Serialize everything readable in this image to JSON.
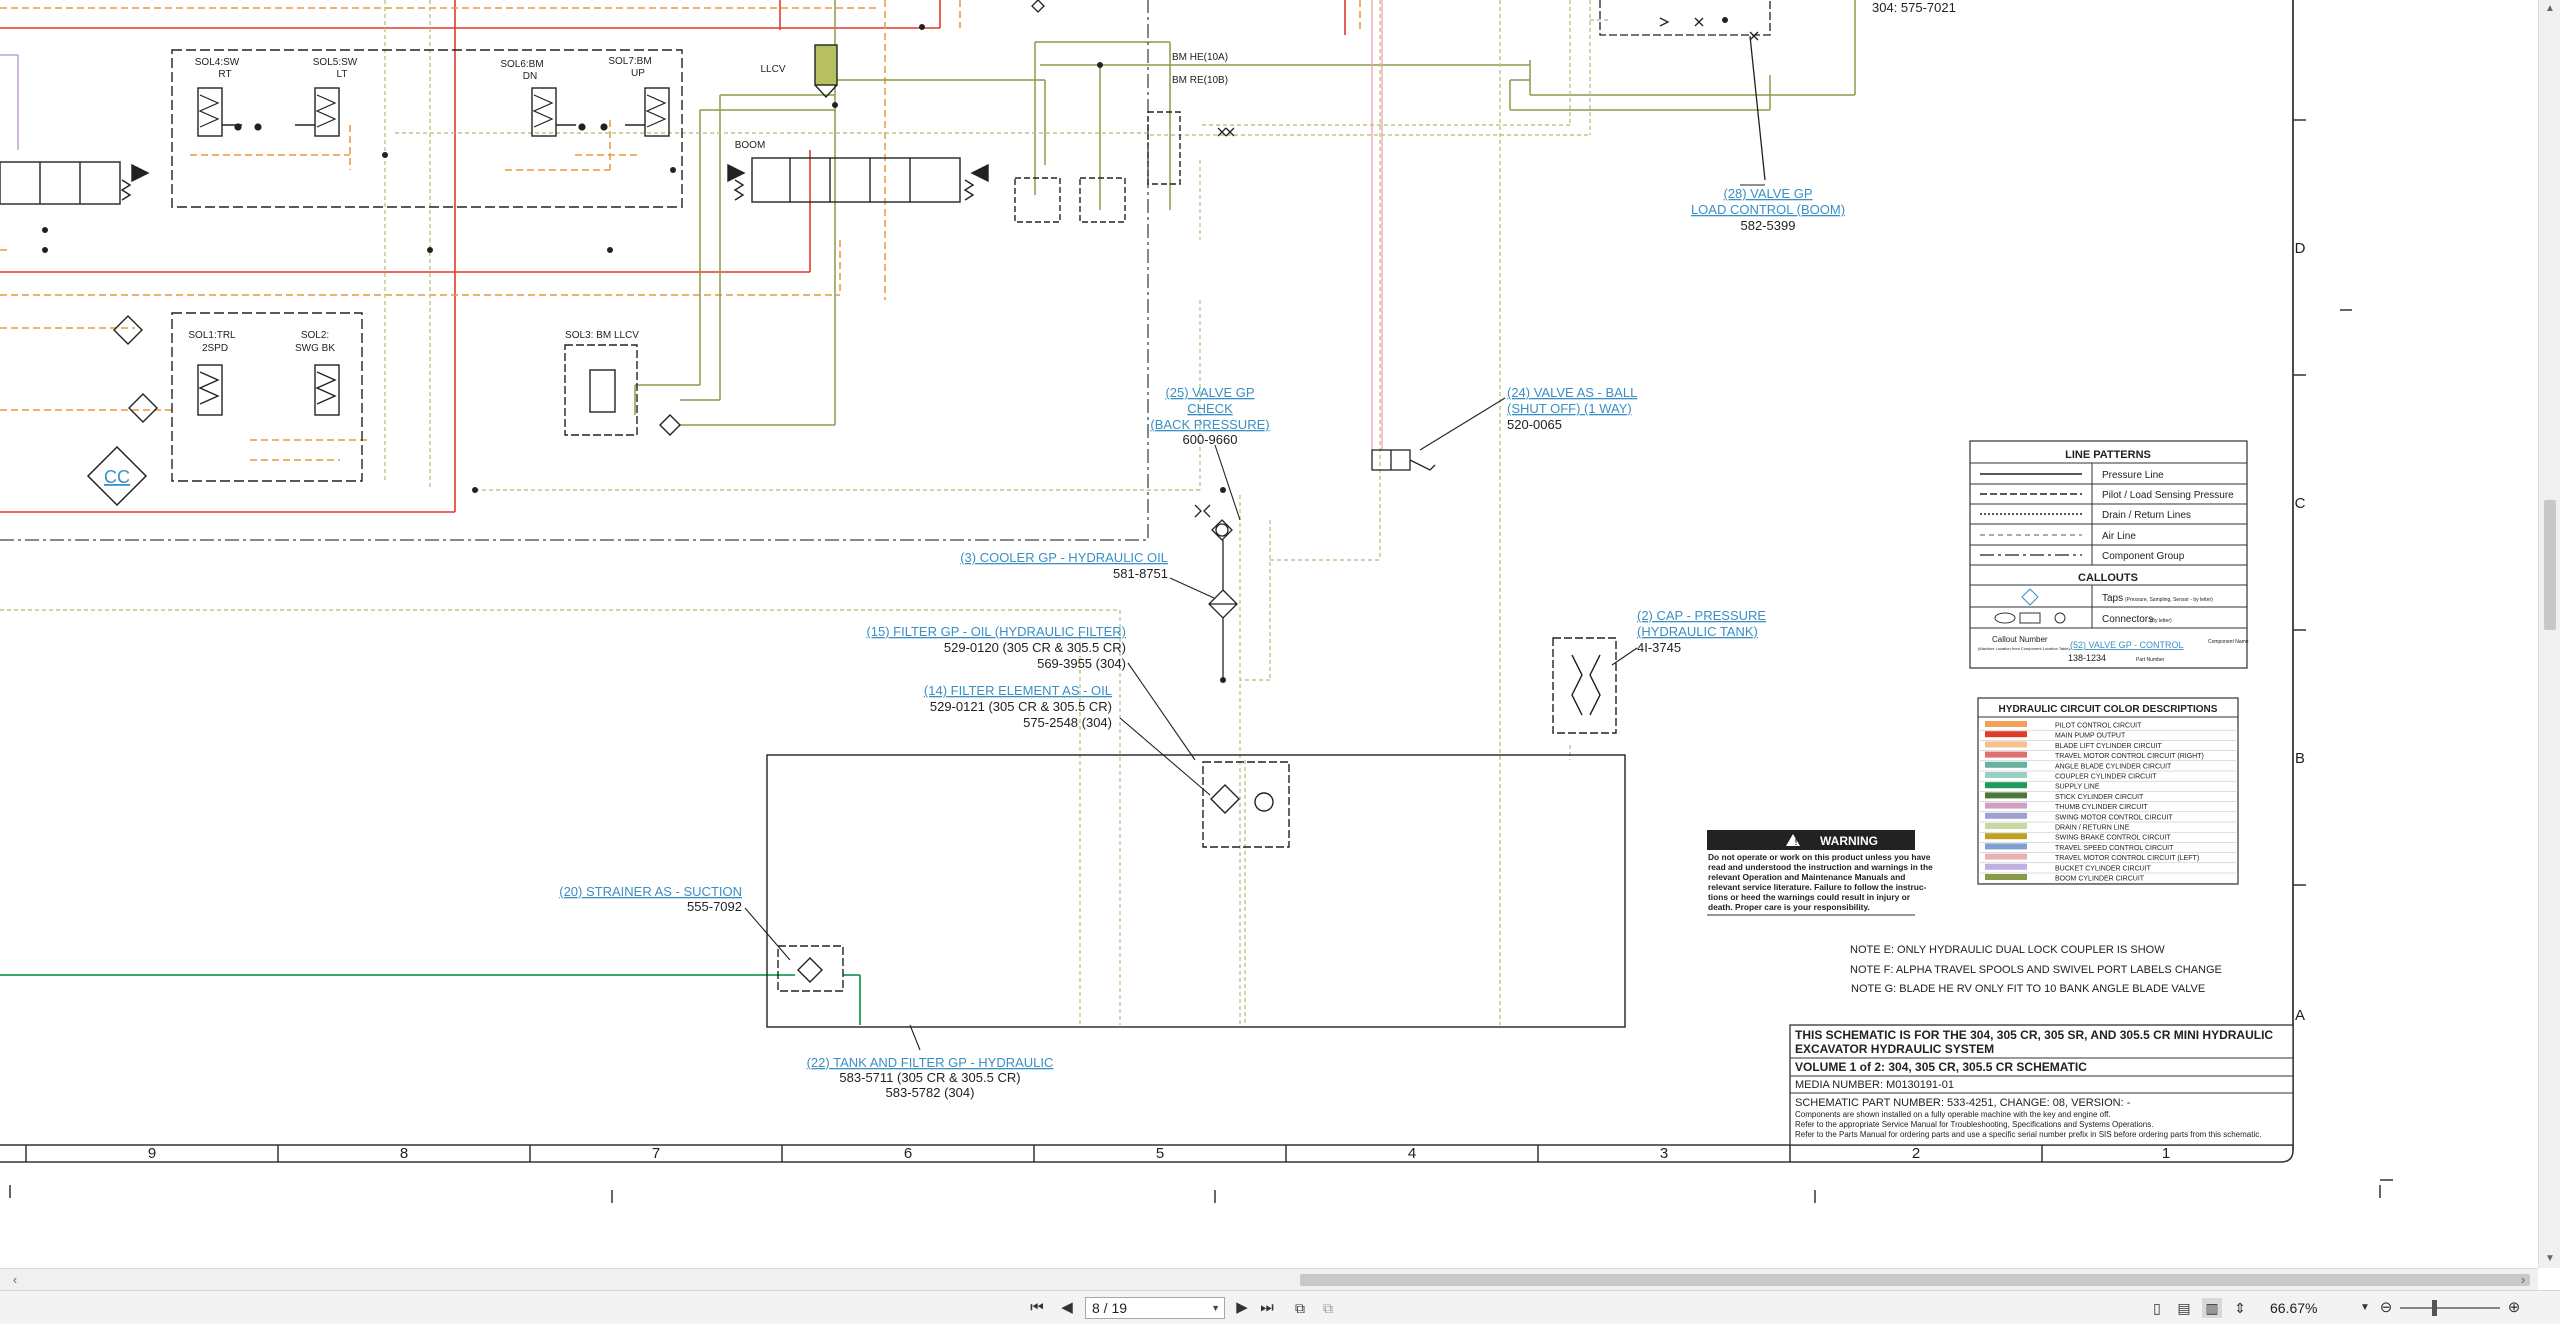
{
  "app": {
    "page_indicator": "8 / 19",
    "zoom": "66.67%"
  },
  "colors": {
    "pressure_red": "#e03a2a",
    "pilot_orange": "#e89a3a",
    "boom_olive": "#8a9a4a",
    "return_green": "#b7c98a",
    "supply_green": "#1f9a5a",
    "callout_blue": "#3a8fc4",
    "pink_line": "#f0a0a8",
    "lilac_line": "#b090d0"
  },
  "schematic": {
    "top_part_number": "304: 575-7021",
    "component_labels": {
      "sol4": "SOL4:SW",
      "sol4b": "RT",
      "sol5": "SOL5:SW",
      "sol5b": "LT",
      "sol6": "SOL6:BM",
      "sol6b": "DN",
      "sol7": "SOL7:BM",
      "sol7b": "UP",
      "llcv": "LLCV",
      "boom": "BOOM",
      "bm_he": "BM HE(10A)",
      "bm_re": "BM RE(10B)",
      "sol1": "SOL1:TRL",
      "sol1b": "2SPD",
      "sol2": "SOL2:",
      "sol2b": "SWG BK",
      "sol3": "SOL3: BM LLCV",
      "cc": "CC"
    },
    "callouts": [
      {
        "lines": [
          "(28) VALVE GP",
          "LOAD CONTROL (BOOM)"
        ],
        "part": [
          "582-5399"
        ]
      },
      {
        "lines": [
          "(24) VALVE AS - BALL",
          "(SHUT OFF) (1 WAY)"
        ],
        "part": [
          "520-0065"
        ]
      },
      {
        "lines": [
          "(25) VALVE GP",
          "CHECK",
          "(BACK PRESSURE)"
        ],
        "part": [
          "600-9660"
        ]
      },
      {
        "lines": [
          "(3) COOLER GP - HYDRAULIC OIL"
        ],
        "part": [
          "581-8751"
        ]
      },
      {
        "lines": [
          "(15) FILTER GP - OIL (HYDRAULIC FILTER)"
        ],
        "part": [
          "529-0120 (305 CR & 305.5 CR)",
          "569-3955 (304)"
        ]
      },
      {
        "lines": [
          "(14) FILTER ELEMENT AS - OIL"
        ],
        "part": [
          "529-0121 (305 CR & 305.5 CR)",
          "575-2548 (304)"
        ]
      },
      {
        "lines": [
          "(2) CAP - PRESSURE",
          "(HYDRAULIC TANK)"
        ],
        "part": [
          "4I-3745"
        ]
      },
      {
        "lines": [
          "(20) STRAINER AS - SUCTION"
        ],
        "part": [
          "555-7092"
        ]
      },
      {
        "lines": [
          "(22) TANK AND FILTER GP - HYDRAULIC"
        ],
        "part": [
          "583-5711 (305 CR & 305.5 CR)",
          "583-5782 (304)"
        ]
      }
    ],
    "line_patterns": {
      "title": "LINE PATTERNS",
      "items": [
        "Pressure Line",
        "Pilot / Load Sensing Pressure",
        "Drain / Return Lines",
        "Air Line",
        "Component Group"
      ],
      "callouts_title": "CALLOUTS",
      "taps_label": "Taps",
      "taps_note": "(Pressure, Sampling, Sensor - by letter)",
      "connectors_label": "Connectors",
      "connectors_note": "(By letter)",
      "example_callout_number": "Callout Number",
      "example_callout_note": "(Machine Location from Component Location Table)",
      "example_callout_name": "(52) VALVE GP - CONTROL",
      "example_component_name": "Component Name",
      "example_part": "138-1234",
      "example_part_label": "Part Number"
    },
    "color_desc": {
      "title": "HYDRAULIC CIRCUIT COLOR DESCRIPTIONS",
      "items": [
        {
          "label": "PILOT CONTROL CIRCUIT",
          "color": "#f2a05a"
        },
        {
          "label": "MAIN PUMP OUTPUT",
          "color": "#e03a2a"
        },
        {
          "label": "BLADE LIFT CYLINDER CIRCUIT",
          "color": "#f6c08a"
        },
        {
          "label": "TRAVEL MOTOR CONTROL CIRCUIT (RIGHT)",
          "color": "#e07070"
        },
        {
          "label": "ANGLE BLADE CYLINDER CIRCUIT",
          "color": "#6ab0a0"
        },
        {
          "label": "COUPLER CYLINDER CIRCUIT",
          "color": "#9ad0c0"
        },
        {
          "label": "SUPPLY LINE",
          "color": "#1f9a5a"
        },
        {
          "label": "STICK CYLINDER CIRCUIT",
          "color": "#4a7a3a"
        },
        {
          "label": "THUMB CYLINDER CIRCUIT",
          "color": "#d0a0c0"
        },
        {
          "label": "SWING MOTOR CONTROL CIRCUIT",
          "color": "#a0a0d0"
        },
        {
          "label": "DRAIN / RETURN LINE",
          "color": "#c8d8a0"
        },
        {
          "label": "SWING BRAKE CONTROL CIRCUIT",
          "color": "#c0a020"
        },
        {
          "label": "TRAVEL SPEED CONTROL CIRCUIT",
          "color": "#80a0d0"
        },
        {
          "label": "TRAVEL MOTOR CONTROL CIRCUIT (LEFT)",
          "color": "#e8b0b0"
        },
        {
          "label": "BUCKET CYLINDER CIRCUIT",
          "color": "#c0b0e0"
        },
        {
          "label": "BOOM CYLINDER CIRCUIT",
          "color": "#8a9a4a"
        }
      ]
    },
    "warning": {
      "title": "WARNING",
      "lines": [
        "Do not operate or work on this product unless you have",
        "read and understood the instruction and warnings in the",
        "relevant Operation and Maintenance Manuals and",
        "relevant service literature. Failure to follow the instruc-",
        "tions or heed the warnings could result in injury or",
        "death. Proper care is your responsibility."
      ]
    },
    "notes": [
      "NOTE E: ONLY HYDRAULIC DUAL LOCK COUPLER IS SHOW",
      "NOTE F: ALPHA TRAVEL SPOOLS AND SWIVEL PORT LABELS CHANGE",
      "NOTE G: BLADE HE RV ONLY FIT TO 10 BANK ANGLE BLADE VALVE"
    ],
    "title_block": {
      "line1": "THIS SCHEMATIC IS FOR THE 304, 305 CR, 305 SR, AND 305.5 CR MINI HYDRAULIC",
      "line2": "EXCAVATOR HYDRAULIC SYSTEM",
      "line3": "VOLUME 1 of 2: 304, 305 CR, 305.5 CR SCHEMATIC",
      "line4": "MEDIA NUMBER: M0130191-01",
      "line5": "SCHEMATIC PART NUMBER: 533-4251, CHANGE: 08, VERSION: -",
      "line6": "Components are shown installed on a fully operable machine with the key and engine off.",
      "line7": "Refer to the appropriate Service Manual for Troubleshooting, Specifications and Systems Operations.",
      "line8": "Refer to the Parts Manual for ordering parts and use a specific serial number prefix in SIS before ordering parts from this schematic."
    },
    "zone_columns": [
      "9",
      "8",
      "7",
      "6",
      "5",
      "4",
      "3",
      "2",
      "1"
    ],
    "zone_rows": [
      "D",
      "C",
      "B",
      "A"
    ]
  }
}
